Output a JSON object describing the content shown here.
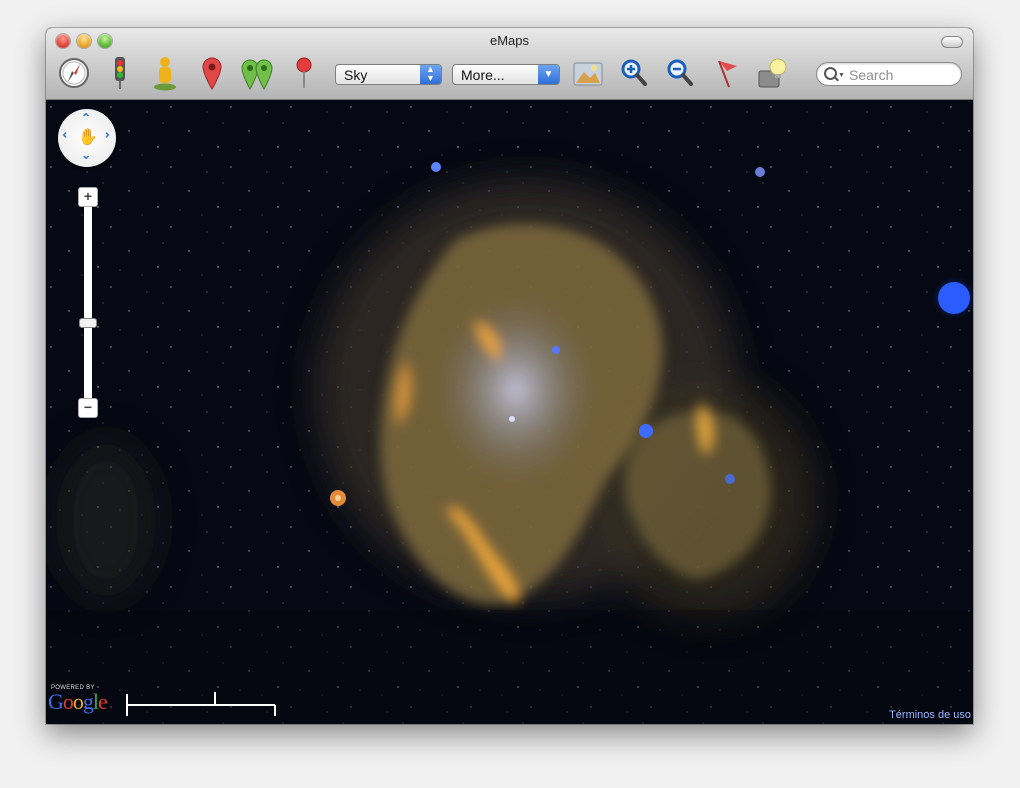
{
  "window": {
    "title": "eMaps"
  },
  "toolbar": {
    "icons": [
      "compass-icon",
      "traffic-light-icon",
      "street-view-icon",
      "pin-icon",
      "route-pins-icon",
      "push-pin-icon",
      "map-image-icon",
      "zoom-in-icon",
      "zoom-out-icon",
      "flag-icon",
      "info-lamp-icon"
    ],
    "map_type_select": "Sky",
    "more_select": "More...",
    "search": {
      "placeholder": "Search"
    }
  },
  "map": {
    "controls": {
      "zoom_in_label": "+",
      "zoom_out_label": "−"
    },
    "attribution": {
      "powered_by": "POWERED BY",
      "brand": "Google"
    },
    "terms_link": "Términos de uso"
  }
}
